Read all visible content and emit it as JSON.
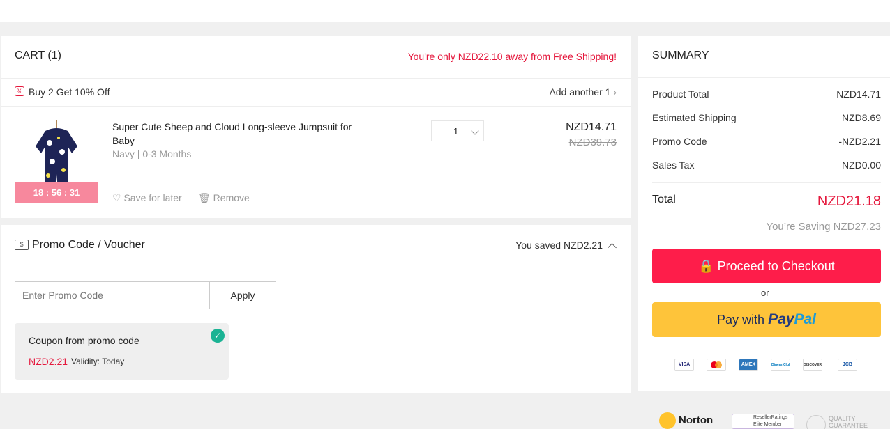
{
  "cart": {
    "title": "CART (1)",
    "free_shipping": "You're only NZD22.10 away from Free Shipping!",
    "offer": "Buy 2 Get 10% Off",
    "add_another": "Add another 1",
    "item": {
      "name": "Super Cute Sheep and Cloud Long-sleeve Jumpsuit for Baby",
      "variant": "Navy | 0-3 Months",
      "quantity": "1",
      "price": "NZD14.71",
      "original_price": "NZD39.73",
      "timer": "18 : 56 : 31",
      "save_for_later": "Save for later",
      "remove": "Remove"
    }
  },
  "promo": {
    "title": "Promo Code / Voucher",
    "saved": "You saved NZD2.21",
    "input_placeholder": "Enter Promo Code",
    "apply": "Apply",
    "coupon": {
      "title": "Coupon from promo code",
      "amount": "NZD2.21",
      "validity": "Validity: Today"
    }
  },
  "summary": {
    "title": "SUMMARY",
    "rows": [
      {
        "label": "Product Total",
        "value": "NZD14.71"
      },
      {
        "label": "Estimated Shipping",
        "value": "NZD8.69"
      },
      {
        "label": "Promo Code",
        "value": "-NZD2.21"
      },
      {
        "label": "Sales Tax",
        "value": "NZD0.00"
      }
    ],
    "total_label": "Total",
    "total_value": "NZD21.18",
    "saving": "You’re Saving NZD27.23",
    "checkout": "Proceed to Checkout",
    "or": "or",
    "paypal_prefix": "Pay with",
    "paypal_brand_1": "Pay",
    "paypal_brand_2": "Pal",
    "payment_methods": [
      "VISA",
      "mastercard",
      "AMEX",
      "Diners Club",
      "DISCOVER",
      "JCB"
    ]
  },
  "badges": {
    "norton": "Norton",
    "reseller_1": "ResellerRatings",
    "reseller_2": "Elite Member",
    "quality_1": "QUALITY",
    "quality_2": "GUARANTEE"
  },
  "colors": {
    "accent": "#e5173c",
    "checkout": "#fe1d4a",
    "paypal": "#fec43a",
    "check": "#1bb394"
  }
}
